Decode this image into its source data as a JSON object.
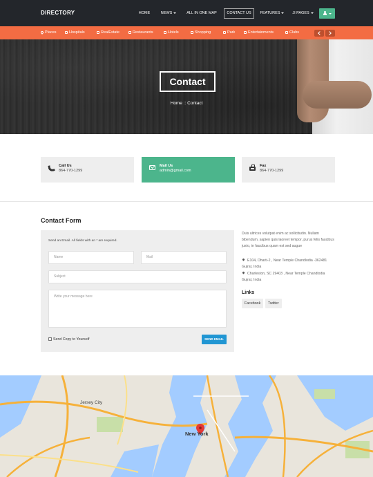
{
  "brand": "DIRECTORY",
  "nav": {
    "home": "HOME",
    "news": "NEWS",
    "all_in_one_map": "ALL IN ONE MAP",
    "contact_us": "CONTACT US",
    "features": "FEATURES",
    "ji_pages": "JI PAGES"
  },
  "categories": [
    "Places",
    "Hospitals",
    "RealEstate",
    "Restaurants",
    "Hotels",
    "Shopping",
    "Park",
    "Entertainments",
    "Clubs"
  ],
  "hero": {
    "title": "Contact",
    "breadcrumb": "Home :: Contact"
  },
  "cards": {
    "call": {
      "title": "Call Us",
      "value": "864-770-1299"
    },
    "mail": {
      "title": "Mail Us",
      "value": "admin@gmail.com"
    },
    "fax": {
      "title": "Fax",
      "value": "864-770-1299"
    }
  },
  "form": {
    "title": "Contact Form",
    "note": "Send an Email. All fields with an * are required.",
    "name_placeholder": "Name",
    "mail_placeholder": "Mail",
    "subject_placeholder": "Subject",
    "message_placeholder": "Write your message here",
    "copy_label": "Send Copy to Yourself",
    "send_label": "SEND EMAIL"
  },
  "sidebar": {
    "about": "Duis ultrices volutpat enim ac sollicitudin. Nullam bibendum, sapien quis laoreet tempor, purus felis faucibus justo, in faucibus quam est sed augue",
    "address1": "E104, Dharti-2 , Near Temple Chandlodia -362481 Gujrat, India",
    "address2": "Charleston, SC 29403 , Near Temple Chandlodia Gujrat, India",
    "links_title": "Links",
    "links": [
      "Facebook",
      "Twitter"
    ]
  },
  "map": {
    "city_label": "New York",
    "label_jersey": "Jersey City"
  },
  "colors": {
    "accent_orange": "#f36c43",
    "accent_green": "#4cb58c",
    "button_blue": "#2196d3",
    "topbar": "#23262b"
  }
}
